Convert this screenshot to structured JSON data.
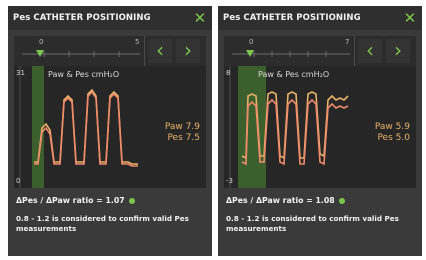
{
  "panels": [
    {
      "header": {
        "title": "Pes CATHETER POSITIONING",
        "close_icon": "close-icon"
      },
      "toolbar": {
        "scale_start": "0",
        "scale_end": "5",
        "prev_icon": "chevron-left-icon",
        "next_icon": "chevron-right-icon"
      },
      "plot": {
        "legend": "Paw & Pes cmH₂O",
        "y_top": "31",
        "y_bottom": "0",
        "paw_label": "Paw",
        "pes_label": "Pes",
        "paw_value": "7.9",
        "pes_value": "7.5"
      },
      "ratio_text": "ΔPes / ΔPaw ratio = 1.07",
      "note_text": "0.8 - 1.2 is considered to confirm valid Pes measurements"
    },
    {
      "header": {
        "title": "Pes CATHETER POSITIONING",
        "close_icon": "close-icon"
      },
      "toolbar": {
        "scale_start": "0",
        "scale_end": "7",
        "prev_icon": "chevron-left-icon",
        "next_icon": "chevron-right-icon"
      },
      "plot": {
        "legend": "Paw & Pes cmH₂O",
        "y_top": "8",
        "y_bottom": "-3",
        "paw_label": "Paw",
        "pes_label": "Pes",
        "paw_value": "5.9",
        "pes_value": "5.0"
      },
      "ratio_text": "ΔPes / ΔPaw ratio = 1.08",
      "note_text": "0.8 - 1.2 is considered to confirm valid Pes measurements"
    }
  ],
  "colors": {
    "accent": "#7cc64a",
    "paw": "#e9b26a",
    "pes": "#f08a6a"
  }
}
